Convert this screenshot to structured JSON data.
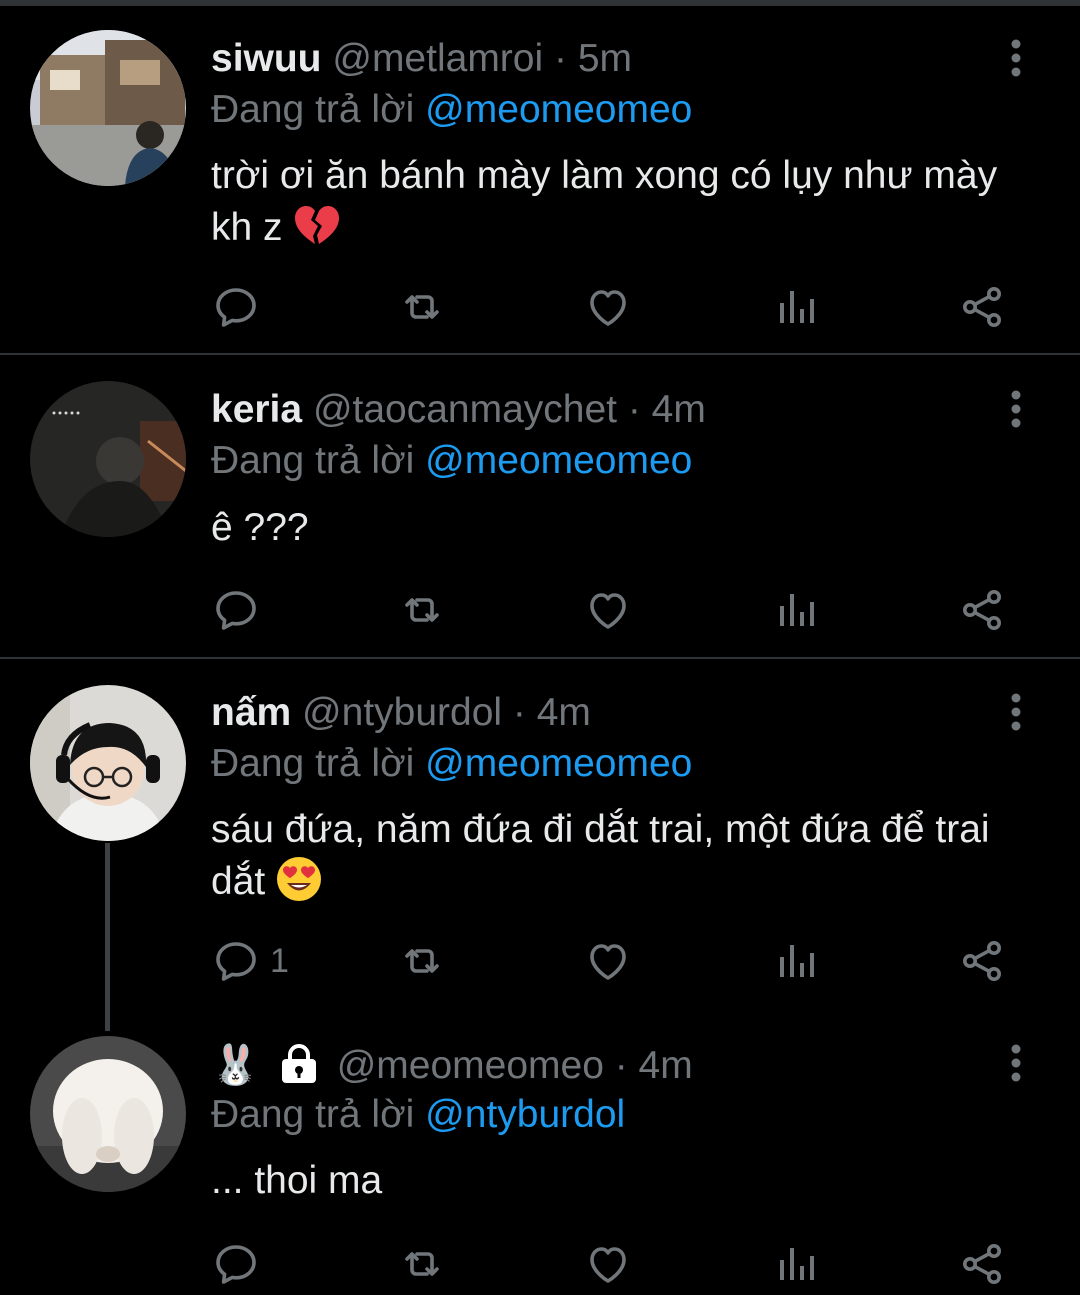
{
  "replying_label": "Đang trả lời",
  "tweets": [
    {
      "name": "siwuu",
      "handle": "@metlamroi",
      "time": "· 5m",
      "replying_to": "@meomeomeo",
      "text": "trời ơi ăn bánh mày làm xong có lụy như mày kh z",
      "emoji": "broken-heart",
      "reply_count": ""
    },
    {
      "name": "keria",
      "handle": "@taocanmaychet",
      "time": "· 4m",
      "replying_to": "@meomeomeo",
      "text": "ê ???",
      "reply_count": ""
    },
    {
      "name": "nấm",
      "handle": "@ntyburdol",
      "time": "· 4m",
      "replying_to": "@meomeomeo",
      "text": "sáu đứa, năm đứa đi dắt trai, một đứa để trai dắt",
      "emoji": "heart-eyes",
      "reply_count": "1"
    },
    {
      "name_emoji": "🐰",
      "protected": true,
      "handle": "@meomeomeo",
      "time": "· 4m",
      "replying_to": "@ntyburdol",
      "text": "... thoi ma",
      "reply_count": ""
    }
  ],
  "colors": {
    "background": "#000000",
    "text": "#e7e9ea",
    "muted": "#71767b",
    "link": "#1d9bf0",
    "divider": "#2f3336"
  },
  "icons": [
    "reply-icon",
    "retweet-icon",
    "like-icon",
    "views-icon",
    "share-icon",
    "more-icon",
    "lock-icon"
  ]
}
